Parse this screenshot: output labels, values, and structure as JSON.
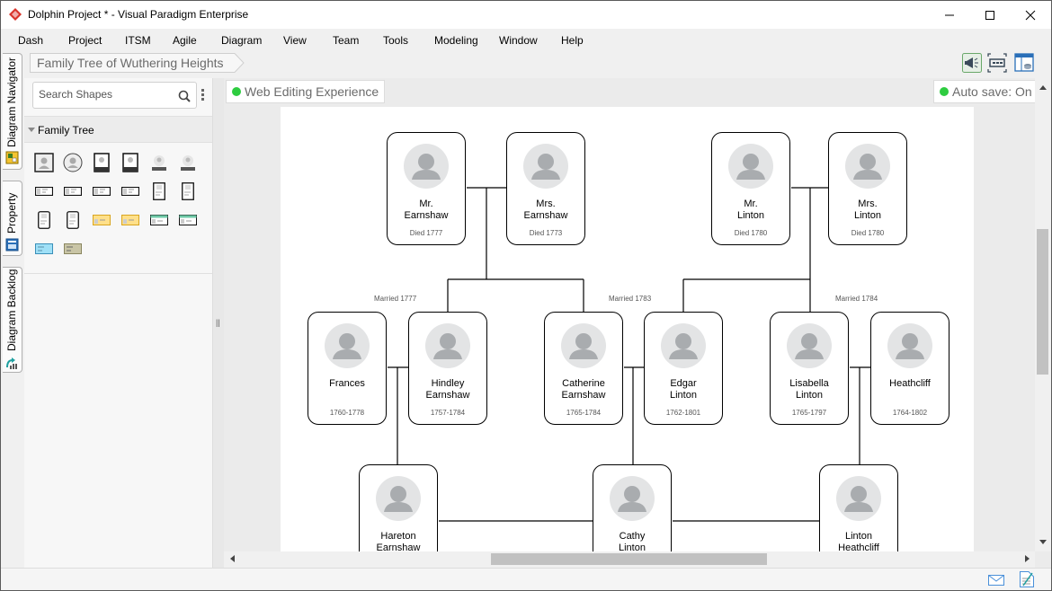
{
  "window": {
    "title": "Dolphin Project * - Visual Paradigm Enterprise",
    "controls": [
      "minimize",
      "maximize",
      "close"
    ]
  },
  "menu": [
    "Dash",
    "Project",
    "ITSM",
    "Agile",
    "Diagram",
    "View",
    "Team",
    "Tools",
    "Modeling",
    "Window",
    "Help"
  ],
  "left_tabs": [
    {
      "label": "Diagram Navigator",
      "icon": "diagram-navigator-icon"
    },
    {
      "label": "Property",
      "icon": "property-icon"
    },
    {
      "label": "Diagram Backlog",
      "icon": "diagram-backlog-icon"
    }
  ],
  "breadcrumb": "Family Tree of Wuthering Heights",
  "shapes_panel": {
    "search_placeholder": "Search Shapes",
    "category": "Family Tree",
    "shape_count": 20
  },
  "toolbar_right": [
    "announcement-icon",
    "fit-diagram-icon",
    "layout-panel-icon"
  ],
  "status_pills": {
    "web_editing": "Web Editing Experience",
    "auto_save": "Auto save: On"
  },
  "diagram": {
    "people": [
      {
        "id": "mr-earnshaw",
        "name": "Mr.\nEarnshaw",
        "sub": "Died 1777"
      },
      {
        "id": "mrs-earnshaw",
        "name": "Mrs.\nEarnshaw",
        "sub": "Died 1773"
      },
      {
        "id": "mr-linton",
        "name": "Mr.\nLinton",
        "sub": "Died 1780"
      },
      {
        "id": "mrs-linton",
        "name": "Mrs.\nLinton",
        "sub": "Died 1780"
      },
      {
        "id": "frances",
        "name": "Frances",
        "sub": "1760-1778"
      },
      {
        "id": "hindley-earnshaw",
        "name": "Hindley\nEarnshaw",
        "sub": "1757-1784"
      },
      {
        "id": "catherine-earnshaw",
        "name": "Catherine\nEarnshaw",
        "sub": "1765-1784"
      },
      {
        "id": "edgar-linton",
        "name": "Edgar\nLinton",
        "sub": "1762-1801"
      },
      {
        "id": "lisabella-linton",
        "name": "Lisabella\nLinton",
        "sub": "1765-1797"
      },
      {
        "id": "heathcliff",
        "name": "Heathcliff",
        "sub": "1764-1802"
      },
      {
        "id": "hareton-earnshaw",
        "name": "Hareton\nEarnshaw",
        "sub": ""
      },
      {
        "id": "cathy-linton",
        "name": "Cathy\nLinton",
        "sub": ""
      },
      {
        "id": "linton-heathcliff",
        "name": "Linton\nHeathcliff",
        "sub": ""
      }
    ],
    "marriages": [
      "Married 1777",
      "Married 1783",
      "Married 1784"
    ]
  },
  "statusbar": [
    "mail-icon",
    "notes-icon"
  ]
}
